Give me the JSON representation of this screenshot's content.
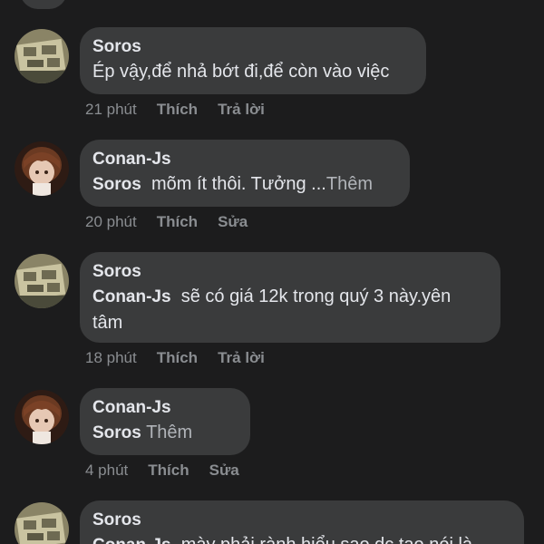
{
  "comments": [
    {
      "author": "Soros",
      "text": "Ép vậy,để nhả bớt đi,để còn vào việc",
      "time": "21 phút",
      "like": "Thích",
      "action2": "Trả lời"
    },
    {
      "author": "Conan-Js",
      "mention": "Soros",
      "text": "mõm ít thôi. Tưởng ...",
      "more": "Thêm",
      "time": "20 phút",
      "like": "Thích",
      "action2": "Sửa"
    },
    {
      "author": "Soros",
      "mention": "Conan-Js",
      "text": "sẽ có giá 12k trong quý 3 này.yên tâm",
      "time": "18 phút",
      "like": "Thích",
      "action2": "Trả lời"
    },
    {
      "author": "Conan-Js",
      "mention": "Soros",
      "more": "Thêm",
      "time": "4 phút",
      "like": "Thích",
      "action2": "Sửa"
    },
    {
      "author": "Soros",
      "mention": "Conan-Js",
      "text": "mày phải rành hiểu sao dc tao nói là"
    }
  ]
}
